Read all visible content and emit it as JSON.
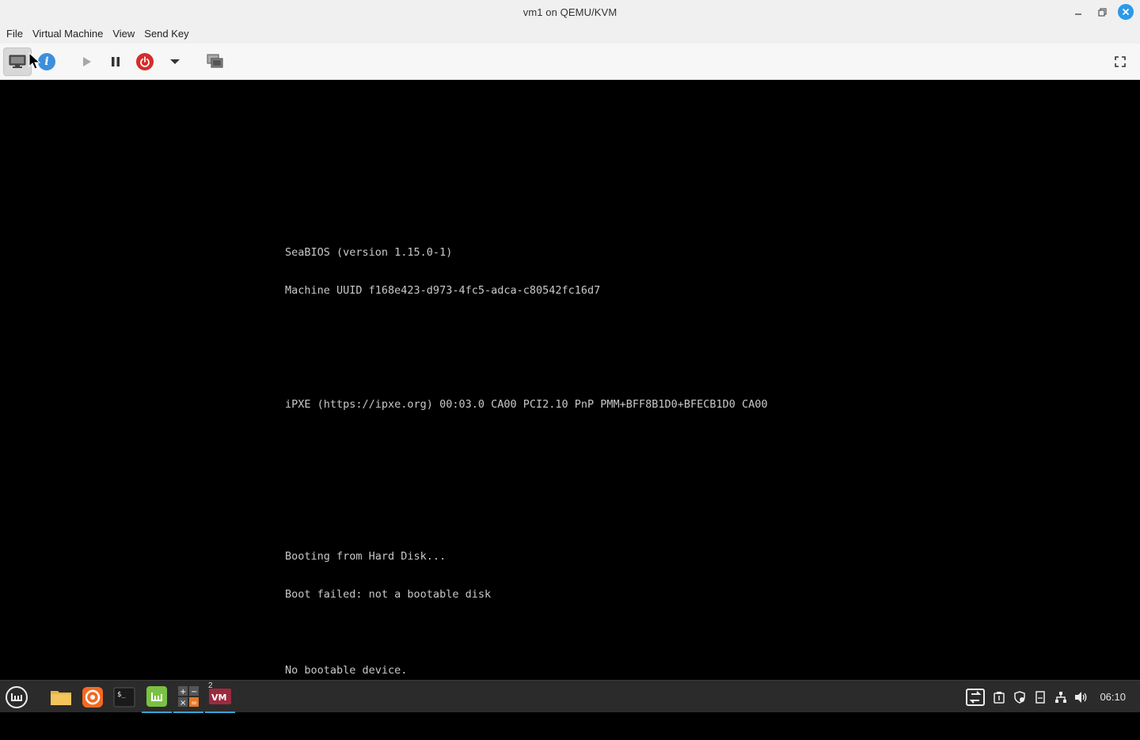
{
  "window": {
    "title": "vm1 on QEMU/KVM",
    "controls": {
      "minimize": "–",
      "maximize": "❐",
      "close": "✕"
    }
  },
  "menubar": {
    "items": [
      {
        "label": "File"
      },
      {
        "label": "Virtual Machine"
      },
      {
        "label": "View"
      },
      {
        "label": "Send Key"
      }
    ]
  },
  "toolbar": {
    "buttons": [
      {
        "name": "console",
        "icon": "monitor-icon",
        "state": "active"
      },
      {
        "name": "details",
        "icon": "info-icon",
        "glyph": "i"
      },
      {
        "name": "run",
        "icon": "play-icon"
      },
      {
        "name": "pause",
        "icon": "pause-icon"
      },
      {
        "name": "shutdown",
        "icon": "power-icon"
      },
      {
        "name": "shutdown-menu",
        "icon": "chevron-down-icon"
      },
      {
        "name": "snapshots",
        "icon": "snapshot-icon"
      },
      {
        "name": "fullscreen",
        "icon": "fullscreen-icon"
      }
    ]
  },
  "console": {
    "lines": [
      "SeaBIOS (version 1.15.0-1)",
      "Machine UUID f168e423-d973-4fc5-adca-c80542fc16d7",
      "",
      "",
      "iPXE (https://ipxe.org) 00:03.0 CA00 PCI2.10 PnP PMM+BFF8B1D0+BFECB1D0 CA00",
      "",
      "",
      "",
      "Booting from Hard Disk...",
      "Boot failed: not a bootable disk",
      "",
      "No bootable device."
    ]
  },
  "taskbar": {
    "apps": [
      {
        "name": "menu",
        "icon": "mint-menu-icon"
      },
      {
        "name": "files",
        "icon": "folder-icon"
      },
      {
        "name": "firefox",
        "icon": "firefox-icon"
      },
      {
        "name": "terminal",
        "icon": "terminal-icon"
      },
      {
        "name": "mintinstall",
        "icon": "mint-software-icon",
        "active": true
      },
      {
        "name": "calculator",
        "icon": "calculator-icon",
        "active": true
      },
      {
        "name": "virt-manager",
        "icon": "vm-icon",
        "active": true,
        "badge": "2"
      }
    ],
    "tray": [
      "screen-switch-icon",
      "clipboard-icon",
      "shield-icon",
      "notes-icon",
      "network-icon",
      "volume-icon"
    ],
    "clock": "06:10"
  },
  "colors": {
    "accent": "#2b9ae8",
    "power": "#d62b2b",
    "info": "#3c8fdc",
    "console_text": "#c8c8c8",
    "taskbar_bg": "#2b2b2b"
  }
}
